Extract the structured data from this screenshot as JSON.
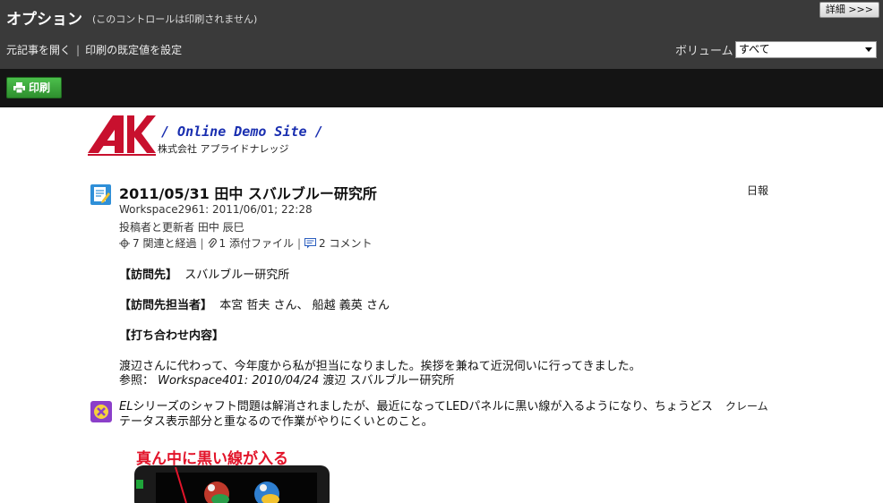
{
  "options": {
    "title": "オプション",
    "note": "(このコントロールは印刷されません)",
    "detail_button": "詳細 >>>",
    "link_open": "元記事を開く",
    "link_separator": "|",
    "link_defaults": "印刷の既定値を設定",
    "volume_label": "ボリューム",
    "volume_selected": "すべて"
  },
  "toolbar": {
    "print_label": "印刷"
  },
  "logo": {
    "site": "/ Online Demo Site /",
    "company": "株式会社 アプライドナレッジ"
  },
  "entry": {
    "title": "2011/05/31 田中 スバルブルー研究所",
    "type": "日報",
    "workspace": "Workspace2961:  2011/06/01; 22:28",
    "author": "投稿者と更新者 田中 辰巳",
    "related": "7 関連と経過",
    "attachments": "1 添付ファイル",
    "comments": "2 コメント",
    "visit_label": "【訪問先】",
    "visit_value": "スバルブルー研究所",
    "contact_label": "【訪問先担当者】",
    "contact_value": "本宮 哲夫 さん、 船越 義英 さん",
    "meeting_label": "【打ち合わせ内容】",
    "meeting_text": "渡辺さんに代わって、今年度から私が担当になりました。挨拶を兼ねて近況伺いに行ってきました。",
    "ref_prefix": "参照：",
    "ref_link": "Workspace401: 2010/04/24",
    "ref_rest": "渡辺 スバルブルー研究所"
  },
  "claim": {
    "lead": "EL",
    "text": "シリーズのシャフト問題は解消されましたが、最近になってLEDパネルに黒い線が入るようになり、ちょうどステータス表示部分と重なるので作業がやりにくいとのこと。",
    "type": "クレーム",
    "photo_caption": "真ん中に黒い線が入る"
  },
  "colors": {
    "options_bg": "#3a3a3a",
    "print_bar_bg": "#141414",
    "print_button": "#3aa83a",
    "logo_red": "#c8102e",
    "logo_blue": "#1a2fb0",
    "caption_red": "#e2142a"
  }
}
